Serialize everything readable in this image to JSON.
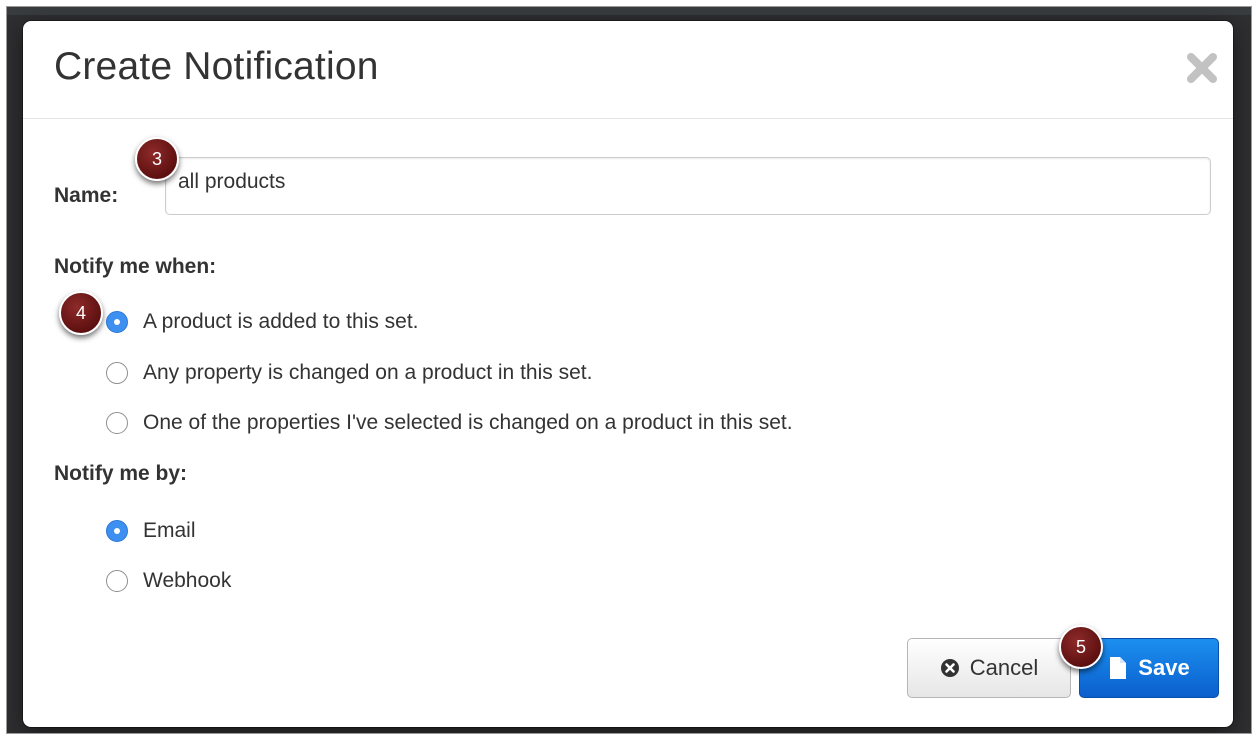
{
  "dialog": {
    "title": "Create Notification",
    "close_icon": "close-icon"
  },
  "name_field": {
    "label": "Name:",
    "value": "all products"
  },
  "notify_when": {
    "label": "Notify me when:",
    "options": [
      {
        "label": "A product is added to this set.",
        "selected": true
      },
      {
        "label": "Any property is changed on a product in this set.",
        "selected": false
      },
      {
        "label": "One of the properties I've selected is changed on a product in this set.",
        "selected": false
      }
    ]
  },
  "notify_by": {
    "label": "Notify me by:",
    "options": [
      {
        "label": "Email",
        "selected": true
      },
      {
        "label": "Webhook",
        "selected": false
      }
    ]
  },
  "buttons": {
    "cancel_label": "Cancel",
    "cancel_icon": "times-circle-icon",
    "save_label": "Save",
    "save_icon": "file-icon"
  },
  "step_badges": [
    "3",
    "4",
    "5"
  ],
  "colors": {
    "accent": "#3d8ff0",
    "primary_button": "#0b6fe0",
    "badge": "#6e1818"
  }
}
